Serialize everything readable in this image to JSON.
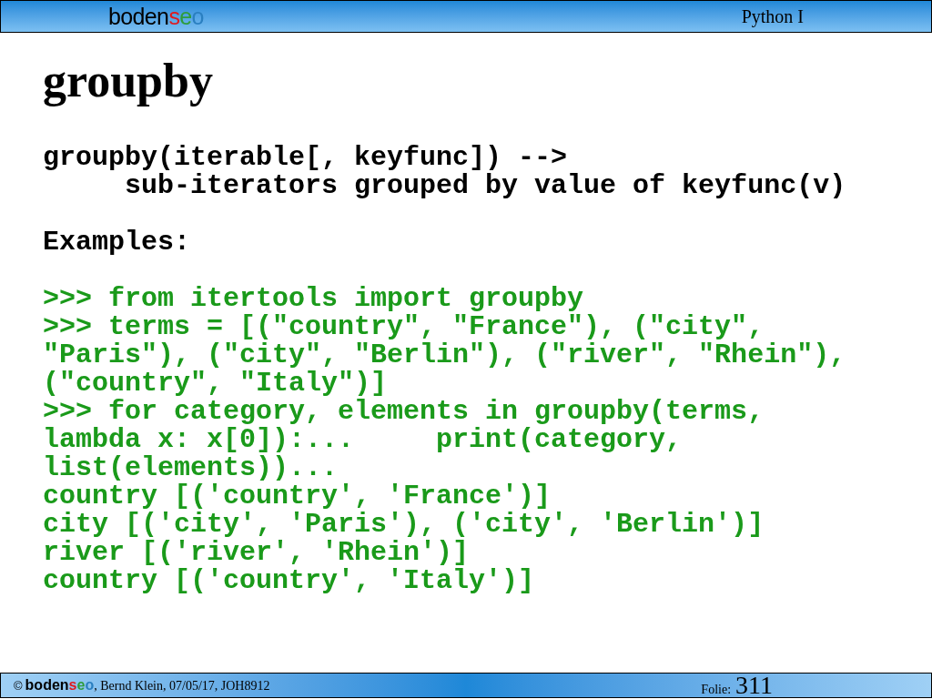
{
  "header": {
    "logo": [
      {
        "text": "boden",
        "color": "#000000"
      },
      {
        "text": "s",
        "color": "#e0191d"
      },
      {
        "text": "e",
        "color": "#2e9c3c"
      },
      {
        "text": "o",
        "color": "#2a7fc0"
      }
    ],
    "course": "Python I"
  },
  "title": "groupby",
  "signature": [
    "groupby(iterable[, keyfunc]) -->",
    "     sub-iterators grouped by value of keyfunc(v)"
  ],
  "examples_label": "Examples:",
  "code": [
    ">>> from itertools import groupby",
    ">>> terms = [(\"country\", \"France\"), (\"city\",",
    "\"Paris\"), (\"city\", \"Berlin\"), (\"river\", \"Rhein\"),",
    "(\"country\", \"Italy\")]",
    ">>> for category, elements in groupby(terms,",
    "lambda x: x[0]):...     print(category,",
    "list(elements))...",
    "country [('country', 'France')]",
    "city [('city', 'Paris'), ('city', 'Berlin')]",
    "river [('river', 'Rhein')]",
    "country [('country', 'Italy')]"
  ],
  "footer": {
    "copyright": "©",
    "logo": [
      {
        "text": "boden",
        "color": "#000000"
      },
      {
        "text": "s",
        "color": "#e0191d"
      },
      {
        "text": "e",
        "color": "#2e9c3c"
      },
      {
        "text": "o",
        "color": "#2a7fc0"
      }
    ],
    "credits": ", Bernd Klein, 07/05/17, JOH8912",
    "slide_label": "Folie:",
    "slide_number": "311"
  }
}
